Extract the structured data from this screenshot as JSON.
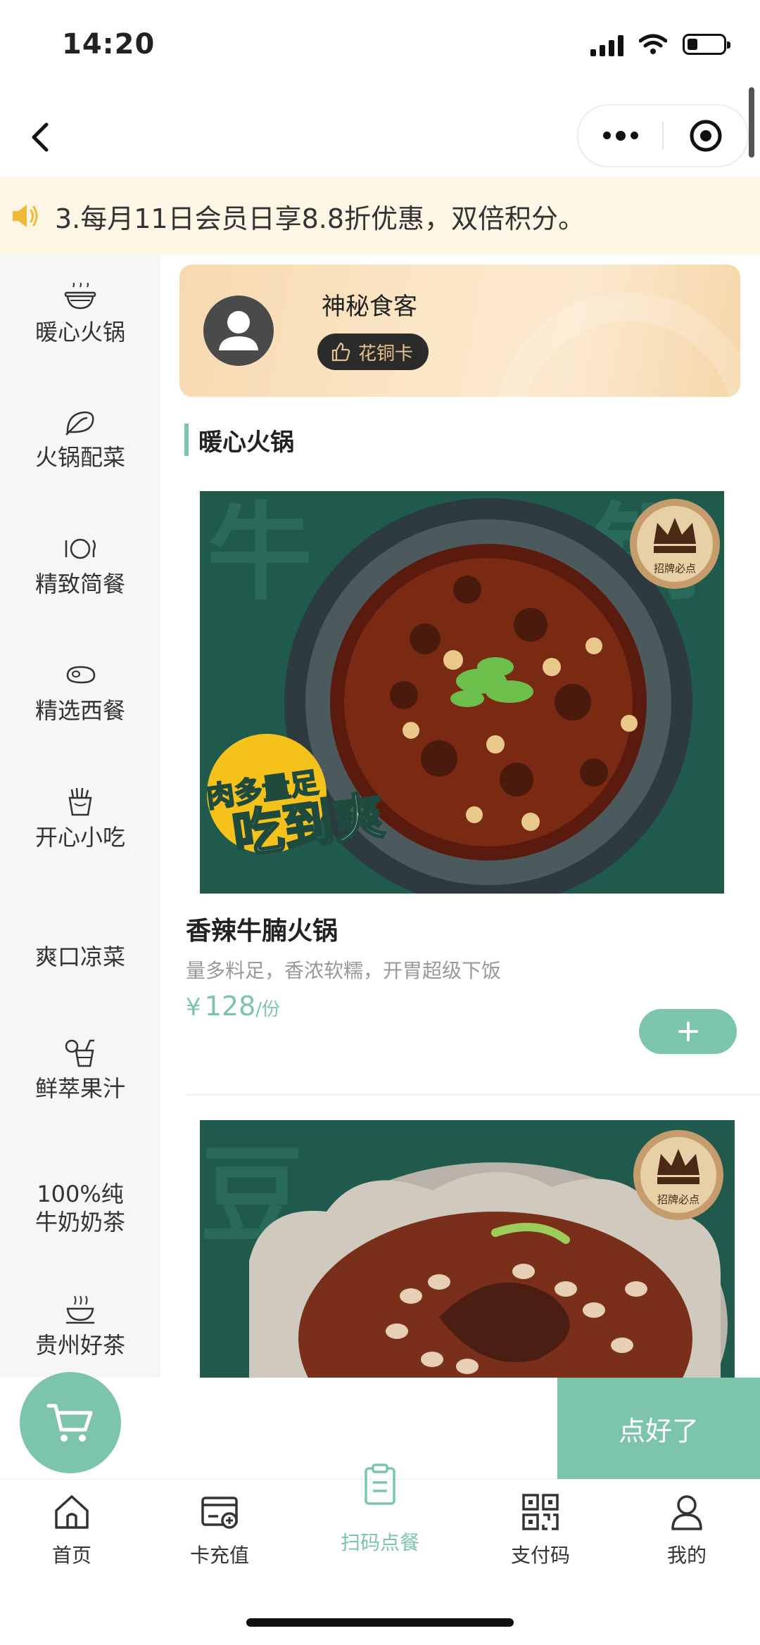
{
  "status_bar": {
    "time": "14:20",
    "battery_level": 0.3
  },
  "nav": {
    "back_icon": "chevron-left-icon",
    "more_icon": "more-dots-icon",
    "close_icon": "target-circle-icon"
  },
  "notice": {
    "icon": "speaker-icon",
    "text": "3.每月11日会员日享8.8折优惠，双倍积分。"
  },
  "sidebar": {
    "items": [
      {
        "label": "暖心火锅",
        "icon": "hotpot-icon"
      },
      {
        "label": "火锅配菜",
        "icon": "vegetable-icon"
      },
      {
        "label": "精致简餐",
        "icon": "plate-cutlery-icon"
      },
      {
        "label": "精选西餐",
        "icon": "steak-icon"
      },
      {
        "label": "开心小吃",
        "icon": "fries-icon"
      },
      {
        "label": "爽口凉菜",
        "icon": ""
      },
      {
        "label": "鲜萃果汁",
        "icon": "juice-icon"
      },
      {
        "label": "100%纯",
        "label2": "牛奶奶茶",
        "icon": ""
      },
      {
        "label": "贵州好茶",
        "icon": "tea-icon"
      }
    ]
  },
  "member": {
    "name": "神秘食客",
    "tier": "花铜卡",
    "avatar_icon": "user-avatar-icon",
    "tier_icon": "thumbs-up-icon"
  },
  "section": {
    "title": "暖心火锅"
  },
  "products": [
    {
      "name": "香辣牛腩火锅",
      "desc": "量多料足，香浓软糯，开胃超级下饭",
      "currency": "¥",
      "price": "128",
      "unit": "/份",
      "badge": "招牌必点",
      "promo_line1": "肉多量足",
      "promo_line2": "吃到爽"
    },
    {
      "badge": "招牌必点"
    }
  ],
  "cart": {
    "icon": "cart-icon",
    "checkout_label": "点好了"
  },
  "tabs": [
    {
      "label": "首页",
      "icon": "home-icon"
    },
    {
      "label": "卡充值",
      "icon": "card-recharge-icon"
    },
    {
      "label": "扫码点餐",
      "icon": "clipboard-icon"
    },
    {
      "label": "支付码",
      "icon": "qr-code-icon"
    },
    {
      "label": "我的",
      "icon": "person-icon"
    }
  ],
  "colors": {
    "accent": "#7cc5ab",
    "notice_bg": "#fdf6e4",
    "sidebar_bg": "#f6f6f6",
    "card_gold": "#f7d9b0"
  }
}
